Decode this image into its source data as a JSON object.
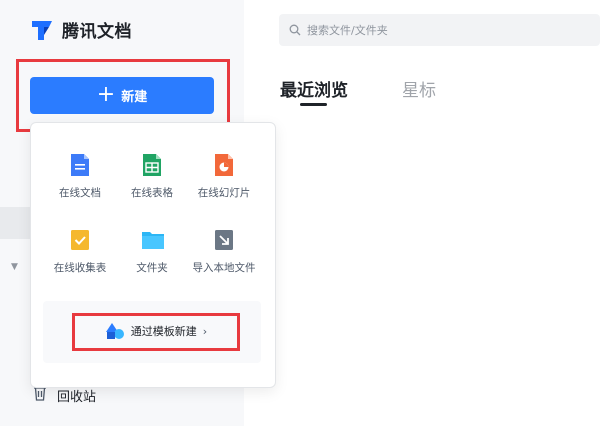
{
  "app": {
    "title": "腾讯文档"
  },
  "sidebar": {
    "new_label": "新建",
    "trash_label": "回收站"
  },
  "search": {
    "placeholder": "搜索文件/文件夹"
  },
  "tabs": [
    {
      "label": "最近浏览"
    },
    {
      "label": "星标"
    }
  ],
  "new_menu": {
    "items": [
      {
        "label": "在线文档",
        "icon": "online-doc-icon",
        "color": "#3d7bf8"
      },
      {
        "label": "在线表格",
        "icon": "online-sheet-icon",
        "color": "#20a464"
      },
      {
        "label": "在线幻灯片",
        "icon": "online-slides-icon",
        "color": "#f2683a"
      },
      {
        "label": "在线收集表",
        "icon": "online-form-icon",
        "color": "#f5b82e"
      },
      {
        "label": "文件夹",
        "icon": "folder-icon",
        "color": "#2cb6f5"
      },
      {
        "label": "导入本地文件",
        "icon": "import-icon",
        "color": "#6b7785"
      }
    ],
    "template_label": "通过模板新建"
  },
  "colors": {
    "accent": "#2b7cff",
    "highlight_box": "#e83a3f"
  }
}
